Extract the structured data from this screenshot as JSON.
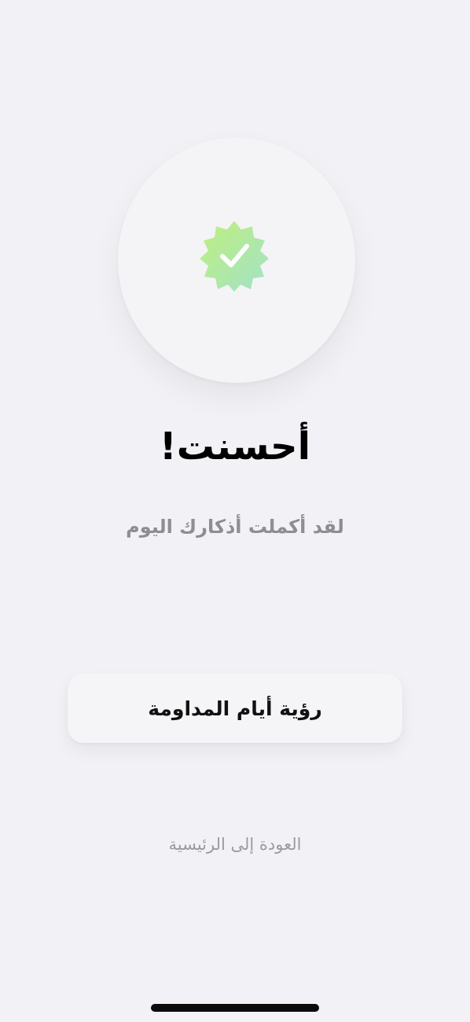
{
  "success": {
    "title": "أحسنت!",
    "subtitle": "لقد أكملت أذكارك اليوم",
    "icon": "verified-badge-check-icon"
  },
  "actions": {
    "primary_label": "رؤية أيام المداومة",
    "secondary_label": "العودة إلى الرئيسية"
  },
  "colors": {
    "background": "#f2f2f6",
    "badge_gradient_start": "#b7ea84",
    "badge_gradient_end": "#a5e5c0",
    "title": "#000000",
    "subtitle": "#8d8d94"
  }
}
